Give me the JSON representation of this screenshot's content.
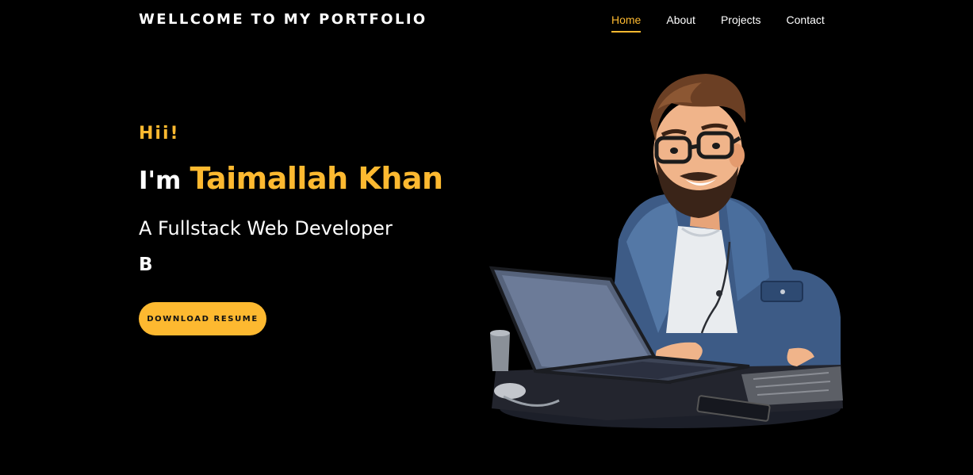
{
  "header": {
    "brand": "WELLCOME TO MY PORTFOLIO",
    "nav": [
      {
        "label": "Home",
        "active": true
      },
      {
        "label": "About",
        "active": false
      },
      {
        "label": "Projects",
        "active": false
      },
      {
        "label": "Contact",
        "active": false
      }
    ]
  },
  "hero": {
    "greeting": "Hii!",
    "intro_prefix": "I'm",
    "name": "Taimallah Khan",
    "role": "A Fullstack Web Developer",
    "typed_text": "B",
    "cta_label": "DOWNLOAD RESUME",
    "illustration_icon": "developer-with-laptop-illustration"
  },
  "colors": {
    "background": "#000000",
    "accent": "#fdb930",
    "text": "#ffffff"
  }
}
